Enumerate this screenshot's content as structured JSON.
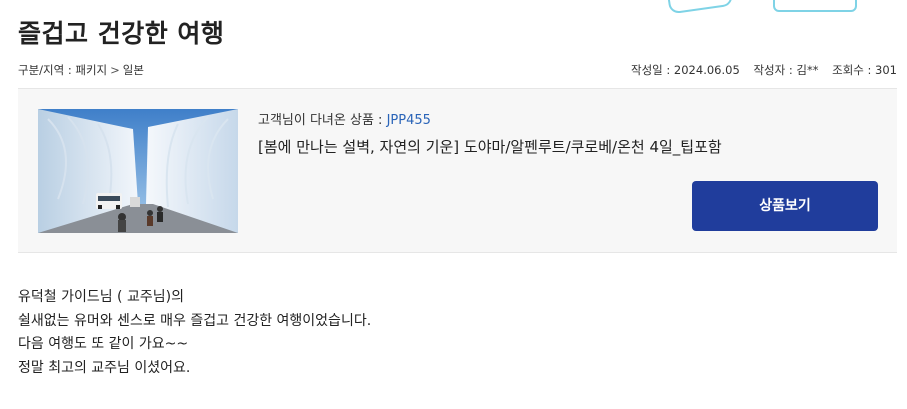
{
  "post": {
    "title": "즐겁고 건강한 여행",
    "category_label": "구분/지역 : 패키지",
    "category_sep": ">",
    "category_region": "일본",
    "date_label": "작성일 : 2024.06.05",
    "author_label": "작성자 : 김**",
    "views_label": "조회수 : 301"
  },
  "product": {
    "code_prefix": "고객님이 다녀온 상품 : ",
    "code": "JPP455",
    "name": "[봄에 만나는 설벽, 자연의 기운] 도야마/알펜루트/쿠로베/온천 4일_팁포함",
    "button_label": "상품보기",
    "image_icon": "snow-wall-photo"
  },
  "content": {
    "lines": [
      "유덕철 가이드님 ( 교주님)의",
      "쉴새없는 유머와 센스로 매우 즐겁고 건강한 여행이었습니다.",
      "다음 여행도 또 같이 가요~~",
      "정말 최고의 교주님 이셨어요."
    ]
  },
  "colors": {
    "accent_button": "#203d9c",
    "code_link": "#2a64b8",
    "box_bg": "#f7f7f7"
  }
}
